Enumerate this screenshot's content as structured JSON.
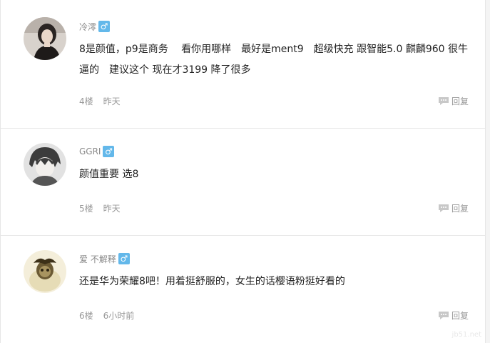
{
  "comments": [
    {
      "username": "冷澪",
      "gender_symbol": "♂",
      "text": "8是颜值，p9是商务　 看你用哪样　最好是ment9　超级快充 跟智能5.0 麒麟960  很牛逼的　建议这个 现在才3199 降了很多",
      "floor": "4楼",
      "time": "昨天",
      "reply_label": "回复",
      "avatar": "avatar-woman-icon"
    },
    {
      "username": "GGRI",
      "gender_symbol": "♂",
      "text": "颜值重要 选8",
      "floor": "5楼",
      "time": "昨天",
      "reply_label": "回复",
      "avatar": "avatar-anime-boy-icon"
    },
    {
      "username": "爱 不解释",
      "gender_symbol": "♂",
      "text": "还是华为荣耀8吧！用着挺舒服的，女生的话樱语粉挺好看的",
      "floor": "6楼",
      "time": "6小时前",
      "reply_label": "回复",
      "avatar": "avatar-cartoon-icon"
    }
  ],
  "colors": {
    "gender_badge": "#63b8ea",
    "meta_text": "#999999",
    "divider": "#e8e8e8"
  },
  "watermark": "jb51.net"
}
